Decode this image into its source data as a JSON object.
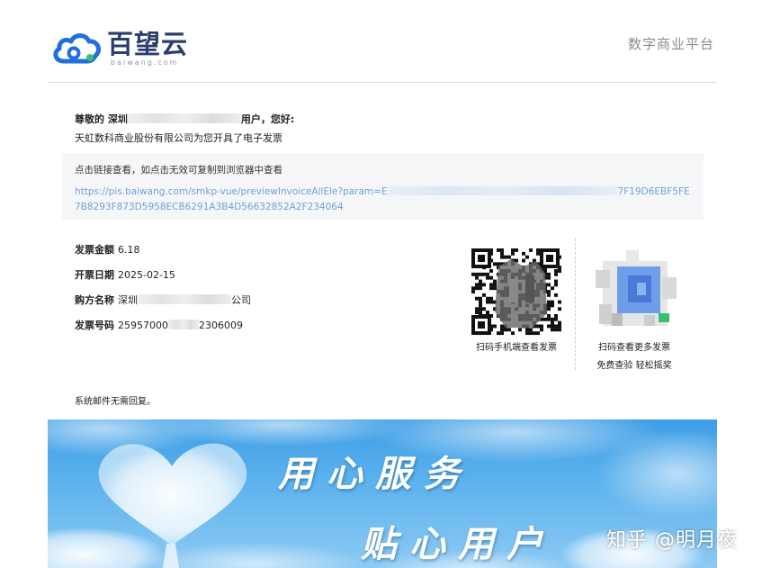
{
  "header": {
    "logo_name": "百望云",
    "logo_sub": "baiwang.com",
    "platform": "数字商业平台",
    "logo_icon": "cloud-logo-icon",
    "colors": {
      "logo_blue": "#1f6fe0",
      "logo_green": "#3bbf6f",
      "logo_text": "#2a3e6c"
    }
  },
  "greeting": {
    "prefix": "尊敬的 深圳",
    "suffix": "用户，您好:",
    "issuer_line": "天虹数科商业股份有限公司为您开具了电子发票"
  },
  "link": {
    "hint": "点击链接查看，如点击无效可复制到浏览器中查看",
    "url_start": "https://pis.baiwang.com/smkp-vue/previewInvoiceAllEle?param=E",
    "url_end": "7F19D6EBF5FE7B8293F873D5958ECB6291A3B4D56632852A2F234064",
    "color": "#6fa0dc"
  },
  "invoice": {
    "amount_label": "发票金额",
    "amount_value": "6.18",
    "date_label": "开票日期",
    "date_value": "2025-02-15",
    "buyer_label": "购方名称",
    "buyer_prefix": "深圳",
    "buyer_suffix": "公司",
    "number_label": "发票号码",
    "number_prefix": "25957000",
    "number_suffix": "2306009"
  },
  "qr": {
    "caption": "扫码手机端查看发票",
    "icon": "qr-code-icon"
  },
  "app": {
    "caption1": "扫码查看更多发票",
    "caption2": "免费查验 轻松摇奖",
    "icon": "app-qr-icon"
  },
  "footer": {
    "noreply": "系统邮件无需回复。"
  },
  "banner": {
    "slogan_line1": "用心服务",
    "slogan_line2": "贴心用户",
    "sky_color": "#3d9ee6"
  },
  "watermark": "知乎 @明月夜"
}
